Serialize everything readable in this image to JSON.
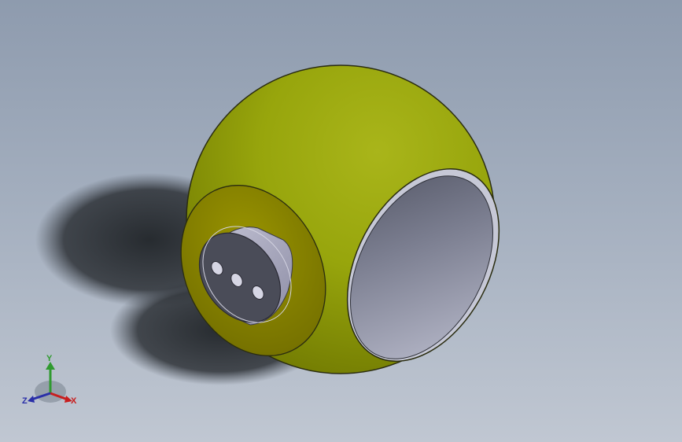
{
  "viewport": {
    "background_top": "#8e9bae",
    "background_bottom": "#c0c7d2"
  },
  "model": {
    "body_color": "#a6b412",
    "bore_color": "#9ea0b4",
    "hub_color": "#a9a9bd",
    "hole_count": 3
  },
  "triad": {
    "x_label": "X",
    "y_label": "Y",
    "z_label": "Z",
    "x_color": "#c81e1e",
    "y_color": "#2f9a2f",
    "z_color": "#2a2fa8"
  }
}
